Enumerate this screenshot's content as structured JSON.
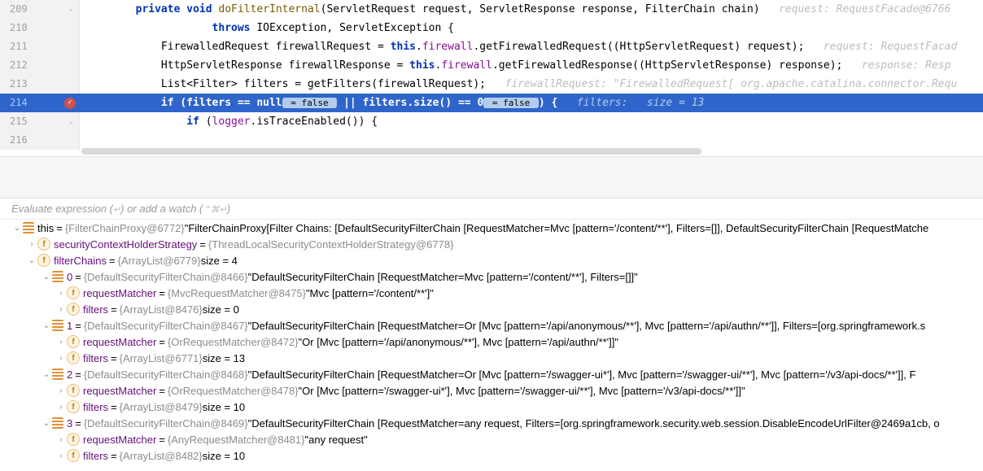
{
  "editor": {
    "lines": [
      {
        "n": "209",
        "marker": "fold",
        "tokens": [
          {
            "pad": 4
          },
          {
            "t": "private ",
            "c": "kw"
          },
          {
            "t": "void ",
            "c": "kw"
          },
          {
            "t": "doFilterInternal",
            "c": "method"
          },
          {
            "t": "(ServletRequest request, ServletResponse response, FilterChain chain)",
            "c": "ident"
          },
          {
            "t": "   request: RequestFacade@6766",
            "c": "inline-hint"
          }
        ]
      },
      {
        "n": "210",
        "tokens": [
          {
            "pad": 10
          },
          {
            "t": "throws ",
            "c": "kw"
          },
          {
            "t": "IOException, ServletException {",
            "c": "ident"
          }
        ]
      },
      {
        "n": "211",
        "tokens": [
          {
            "pad": 6
          },
          {
            "t": "FirewalledRequest firewallRequest = ",
            "c": "ident"
          },
          {
            "t": "this",
            "c": "kwthis"
          },
          {
            "t": ".",
            "c": "ident"
          },
          {
            "t": "firewall",
            "c": "field"
          },
          {
            "t": ".getFirewalledRequest((HttpServletRequest) request);",
            "c": "ident"
          },
          {
            "t": "   request: RequestFacad",
            "c": "inline-hint"
          }
        ]
      },
      {
        "n": "212",
        "tokens": [
          {
            "pad": 6
          },
          {
            "t": "HttpServletResponse firewallResponse = ",
            "c": "ident"
          },
          {
            "t": "this",
            "c": "kwthis"
          },
          {
            "t": ".",
            "c": "ident"
          },
          {
            "t": "firewall",
            "c": "field"
          },
          {
            "t": ".getFirewalledResponse((HttpServletResponse) response);",
            "c": "ident"
          },
          {
            "t": "   response: Resp",
            "c": "inline-hint"
          }
        ]
      },
      {
        "n": "213",
        "tokens": [
          {
            "pad": 6
          },
          {
            "t": "List<Filter> filters = getFilters(firewallRequest);",
            "c": "ident"
          },
          {
            "t": "   firewallRequest: \"FirewalledRequest[ org.apache.catalina.connector.Requ",
            "c": "inline-hint"
          }
        ]
      },
      {
        "n": "214",
        "active": true,
        "marker": "bp",
        "tokens": [
          {
            "pad": 6
          },
          {
            "t": "if ",
            "c": "kw"
          },
          {
            "t": "(filters == ",
            "c": "ident"
          },
          {
            "t": "null",
            "c": "kw"
          },
          {
            "t": " = false ",
            "c": "eval-badge"
          },
          {
            "t": " || filters.size() == ",
            "c": "ident"
          },
          {
            "t": "0",
            "c": "num"
          },
          {
            "t": " = false ",
            "c": "eval-badge"
          },
          {
            "t": ") {",
            "c": "ident"
          },
          {
            "t": "   filters:   size = 13",
            "c": "inline-hint"
          }
        ]
      },
      {
        "n": "215",
        "marker": "fold",
        "tokens": [
          {
            "pad": 8
          },
          {
            "t": "if ",
            "c": "kw"
          },
          {
            "t": "(",
            "c": "ident"
          },
          {
            "t": "logger",
            "c": "field"
          },
          {
            "t": ".isTraceEnabled()) {",
            "c": "ident"
          }
        ]
      },
      {
        "n": "216",
        "tokens": []
      }
    ]
  },
  "watch": {
    "placeholder_a": "Evaluate expression (",
    "placeholder_b": ") or add a watch (",
    "placeholder_c": ")",
    "sc1": "↵",
    "sc2": "⌃⌘↵"
  },
  "vars": [
    {
      "d": 0,
      "arr": "down",
      "icon": "lines",
      "name": "this",
      "nameClass": "thislbl",
      "type": "{FilterChainProxy@6772}",
      "val": "\"FilterChainProxy[Filter Chains: [DefaultSecurityFilterChain [RequestMatcher=Mvc [pattern='/content/**'], Filters=[]], DefaultSecurityFilterChain [RequestMatche"
    },
    {
      "d": 1,
      "arr": "right",
      "icon": "field",
      "name": "securityContextHolderStrategy",
      "type": "{ThreadLocalSecurityContextHolderStrategy@6778}",
      "val": ""
    },
    {
      "d": 1,
      "arr": "down",
      "icon": "field",
      "name": "filterChains",
      "type": "{ArrayList@6779}",
      "val": " size = 4"
    },
    {
      "d": 2,
      "arr": "down",
      "icon": "lines",
      "name": "0",
      "type": "{DefaultSecurityFilterChain@8466}",
      "val": "\"DefaultSecurityFilterChain [RequestMatcher=Mvc [pattern='/content/**'], Filters=[]]\""
    },
    {
      "d": 3,
      "arr": "right",
      "icon": "field",
      "name": "requestMatcher",
      "type": "{MvcRequestMatcher@8475}",
      "val": "\"Mvc [pattern='/content/**']\""
    },
    {
      "d": 3,
      "arr": "right",
      "icon": "field",
      "name": "filters",
      "type": "{ArrayList@8476}",
      "val": " size = 0"
    },
    {
      "d": 2,
      "arr": "down",
      "icon": "lines",
      "name": "1",
      "type": "{DefaultSecurityFilterChain@8467}",
      "val": "\"DefaultSecurityFilterChain [RequestMatcher=Or [Mvc [pattern='/api/anonymous/**'], Mvc [pattern='/api/authn/**']], Filters=[org.springframework.s"
    },
    {
      "d": 3,
      "arr": "right",
      "icon": "field",
      "name": "requestMatcher",
      "type": "{OrRequestMatcher@8472}",
      "val": "\"Or [Mvc [pattern='/api/anonymous/**'], Mvc [pattern='/api/authn/**']]\""
    },
    {
      "d": 3,
      "arr": "right",
      "icon": "field",
      "name": "filters",
      "type": "{ArrayList@6771}",
      "val": " size = 13"
    },
    {
      "d": 2,
      "arr": "down",
      "icon": "lines",
      "name": "2",
      "type": "{DefaultSecurityFilterChain@8468}",
      "val": "\"DefaultSecurityFilterChain [RequestMatcher=Or [Mvc [pattern='/swagger-ui*'], Mvc [pattern='/swagger-ui/**'], Mvc [pattern='/v3/api-docs/**']], F"
    },
    {
      "d": 3,
      "arr": "right",
      "icon": "field",
      "name": "requestMatcher",
      "type": "{OrRequestMatcher@8478}",
      "val": "\"Or [Mvc [pattern='/swagger-ui*'], Mvc [pattern='/swagger-ui/**'], Mvc [pattern='/v3/api-docs/**']]\""
    },
    {
      "d": 3,
      "arr": "right",
      "icon": "field",
      "name": "filters",
      "type": "{ArrayList@8479}",
      "val": " size = 10"
    },
    {
      "d": 2,
      "arr": "down",
      "icon": "lines",
      "name": "3",
      "type": "{DefaultSecurityFilterChain@8469}",
      "val": "\"DefaultSecurityFilterChain [RequestMatcher=any request, Filters=[org.springframework.security.web.session.DisableEncodeUrlFilter@2469a1cb, o"
    },
    {
      "d": 3,
      "arr": "right",
      "icon": "field",
      "name": "requestMatcher",
      "type": "{AnyRequestMatcher@8481}",
      "val": "\"any request\""
    },
    {
      "d": 3,
      "arr": "right",
      "icon": "field",
      "name": "filters",
      "type": "{ArrayList@8482}",
      "val": " size = 10"
    }
  ]
}
